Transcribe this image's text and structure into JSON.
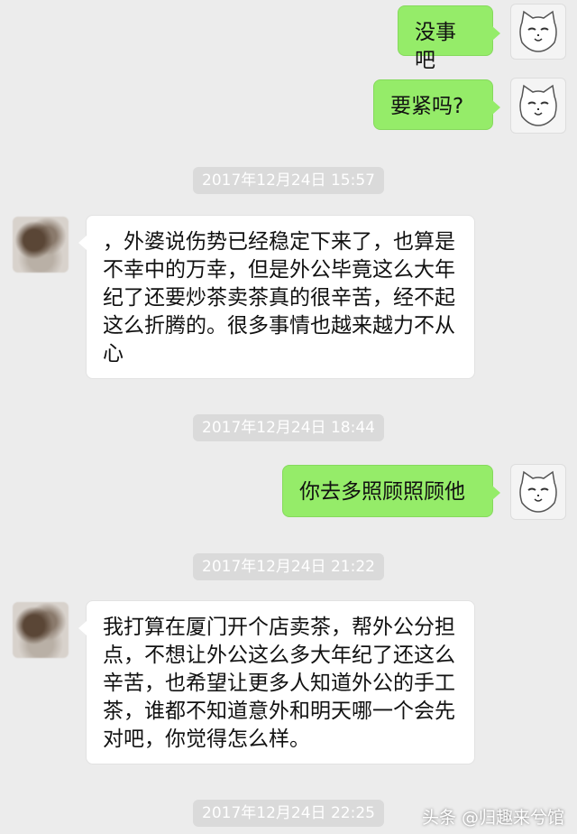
{
  "messages": [
    {
      "side": "me",
      "text": "没事吧"
    },
    {
      "side": "me",
      "text": "要紧吗?"
    },
    {
      "type": "time",
      "text": "2017年12月24日 15:57"
    },
    {
      "side": "other",
      "text": "，外婆说伤势已经稳定下来了，也算是不幸中的万幸，但是外公毕竟这么大年纪了还要炒茶卖茶真的很辛苦，经不起这么折腾的。很多事情也越来越力不从心"
    },
    {
      "type": "time",
      "text": "2017年12月24日 18:44"
    },
    {
      "side": "me",
      "text": "你去多照顾照顾他"
    },
    {
      "type": "time",
      "text": "2017年12月24日 21:22"
    },
    {
      "side": "other",
      "text": "我打算在厦门开个店卖茶，帮外公分担点，不想让外公这么多大年纪了还这么辛苦，也希望让更多人知道外公的手工茶，谁都不知道意外和明天哪一个会先对吧，你觉得怎么样。"
    },
    {
      "type": "time",
      "text": "2017年12月24日 22:25"
    }
  ],
  "watermark": "头条 @归趣来兮馆",
  "colors": {
    "me_bubble": "#95ec69",
    "other_bubble": "#ffffff",
    "background": "#ececec"
  }
}
